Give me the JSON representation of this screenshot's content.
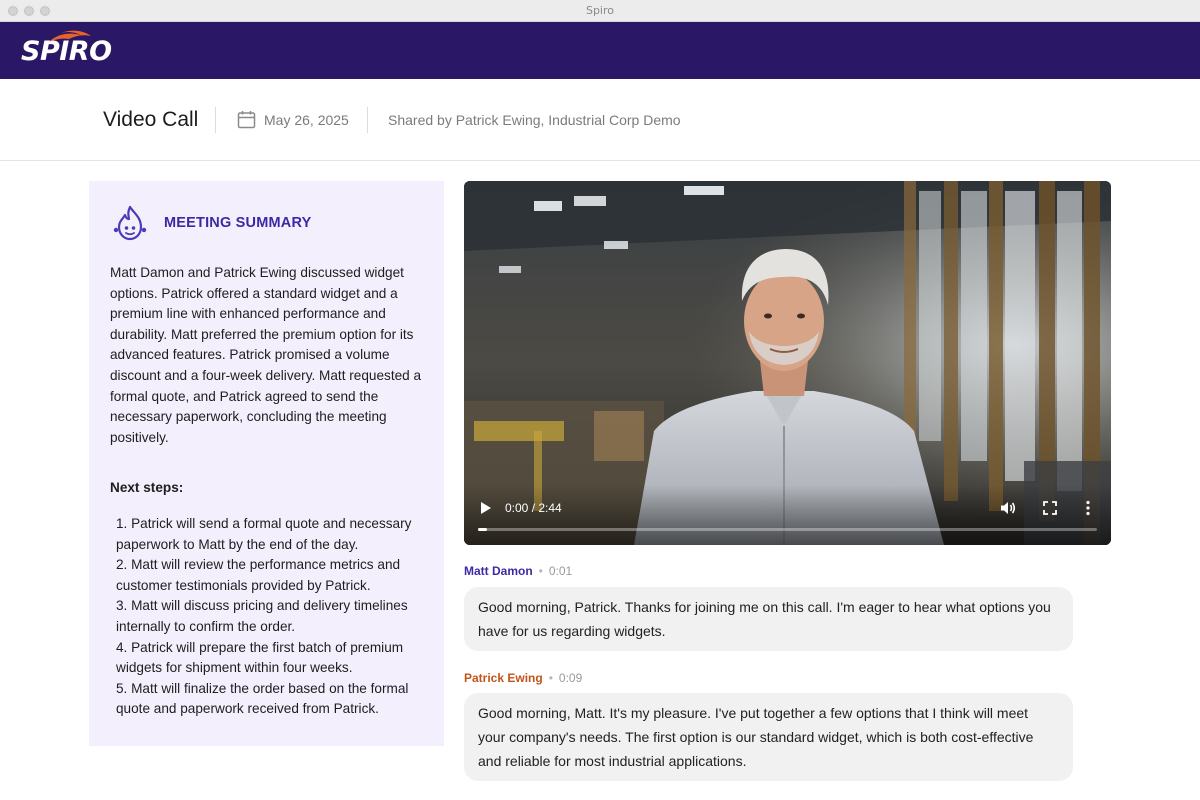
{
  "window": {
    "title": "Spiro"
  },
  "brand": {
    "logo_text": "SPIRO",
    "color": "#2a1765"
  },
  "header": {
    "title": "Video Call",
    "date": "May 26, 2025",
    "shared_by": "Shared by Patrick Ewing, Industrial Corp Demo",
    "calendar_icon": "calendar-icon"
  },
  "summary": {
    "icon": "ai-assistant-icon",
    "title": "MEETING SUMMARY",
    "body": "Matt Damon and Patrick Ewing discussed widget options. Patrick offered a standard widget and a premium line with enhanced performance and durability. Matt preferred the premium option for its advanced features. Patrick promised a volume discount and a four-week delivery. Matt requested a formal quote, and Patrick agreed to send the necessary paperwork, concluding the meeting positively.",
    "next_steps_title": "Next steps:",
    "steps": [
      "1. Patrick will send a formal quote and necessary paperwork to Matt by the end of the day.",
      "2. Matt will review the performance metrics and customer testimonials provided by Patrick.",
      "3. Matt will discuss pricing and delivery timelines internally to confirm the order.",
      "4. Patrick will prepare the first batch of premium widgets for shipment within four weeks.",
      "5. Matt will finalize the order based on the formal quote and paperwork received from Patrick."
    ]
  },
  "video": {
    "time": "0:00 / 2:44",
    "progress": 0.015
  },
  "transcript": [
    {
      "speaker": "Matt Damon",
      "speaker_color": "#3b2aa3",
      "time": "0:01",
      "text": "Good morning, Patrick. Thanks for joining me on this call. I'm eager to hear what options you have for us regarding widgets."
    },
    {
      "speaker": "Patrick Ewing",
      "speaker_color": "#c2551c",
      "time": "0:09",
      "text": "Good morning, Matt. It's my pleasure. I've put together a few options that I think will meet your company's needs. The first option is our standard widget, which is both cost-effective and reliable for most industrial applications."
    }
  ]
}
